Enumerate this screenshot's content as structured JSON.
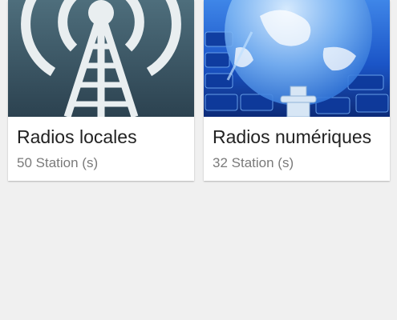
{
  "categories": [
    {
      "title": "Radios locales",
      "count_label": "50 Station (s)",
      "image_icon": "radio-tower-icon"
    },
    {
      "title": "Radios numériques",
      "count_label": "32 Station (s)",
      "image_icon": "globe-keyboard-icon"
    }
  ],
  "colors": {
    "background": "#f0f0f0",
    "card": "#ffffff",
    "title_text": "#222222",
    "subtitle_text": "#7a7a7a",
    "tower_bg_top": "#4b6b78",
    "tower_bg_bottom": "#2f4654",
    "globe_accent": "#1a5fd0"
  }
}
